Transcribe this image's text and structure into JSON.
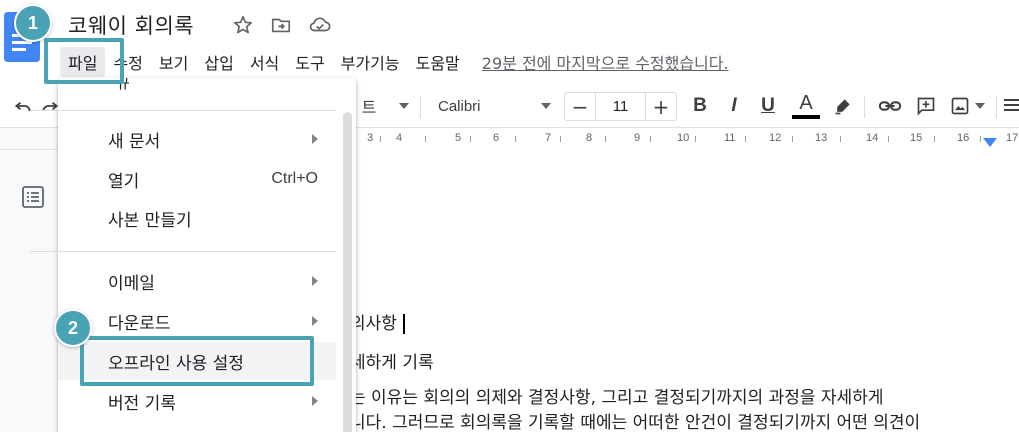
{
  "document": {
    "title": "코웨이 회의록",
    "last_edit": "29분 전에 마지막으로 수정했습니다."
  },
  "menu": {
    "items": [
      "파일",
      "수정",
      "보기",
      "삽입",
      "서식",
      "도구",
      "부가기능",
      "도움말"
    ]
  },
  "toolbar": {
    "style_label": "트",
    "font_name": "Calibri",
    "font_size": "11",
    "minus": "−",
    "plus": "+",
    "bold": "B",
    "italic": "I",
    "underline": "U",
    "text_color_letter": "A"
  },
  "ruler": {
    "numbers": [
      "3",
      "4",
      "5",
      "6",
      "7",
      "8",
      "9",
      "10",
      "11",
      "12",
      "13",
      "14",
      "15",
      "16",
      "17"
    ]
  },
  "file_menu": {
    "partial_top": "규",
    "new_document": "새 문서",
    "open": "열기",
    "open_shortcut": "Ctrl+O",
    "make_copy": "사본 만들기",
    "email": "이메일",
    "download": "다운로드",
    "offline_settings": "오프라인 사용 설정",
    "version_history": "버전 기록"
  },
  "body": {
    "line1": "의사항",
    "line2": "세하게 기록",
    "line3": "는 이유는 회의의 의제와 결정사항, 그리고 결정되기까지의 과정을 자세하게",
    "line4": "니다. 그러므로 회의록을 기록할 때에는 어떠한 안건이 결정되기까지 어떤 의견이"
  },
  "callouts": {
    "step1": "1",
    "step2": "2"
  },
  "colors": {
    "callout": "#4aa3b5",
    "docs_blue": "#4285f4",
    "menu_highlight": "#f1f3f4"
  }
}
